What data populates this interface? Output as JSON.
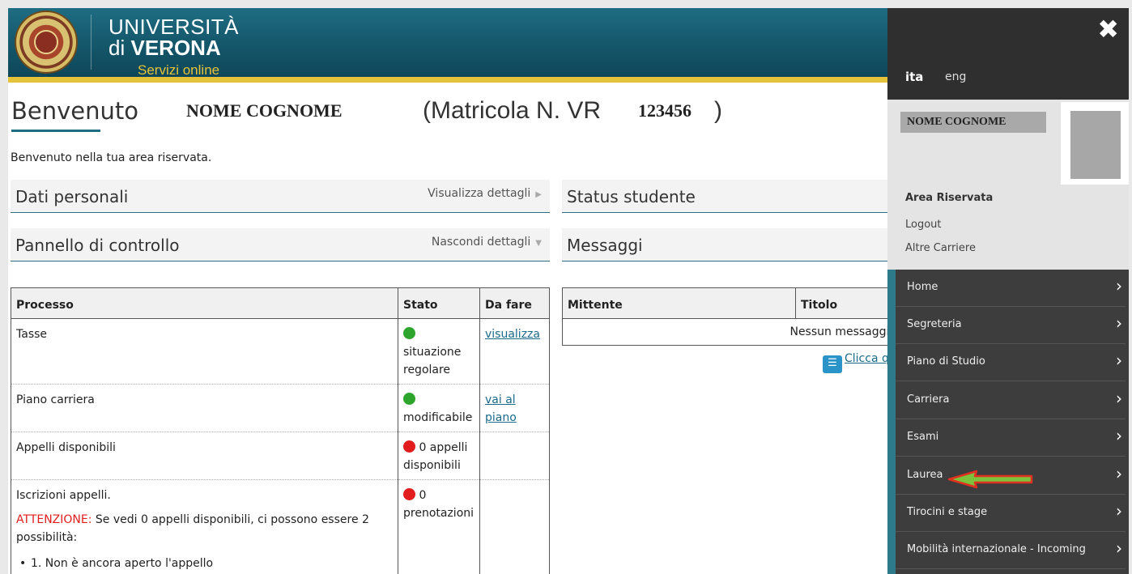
{
  "header": {
    "brand_line1": "UNIVERSITÀ",
    "brand_line2_prefix": "di",
    "brand_line2_bold": "VERONA",
    "brand_line3": "Servizi online",
    "colors": {
      "header": "#165a6e",
      "stripe": "#e4c33a"
    }
  },
  "welcome": {
    "title": "Benvenuto",
    "name": "NOME COGNOME",
    "matricola_prefix": "(Matricola N. VR",
    "matricola_number": "123456",
    "matricola_suffix": ")",
    "intro": "Benvenuto nella tua area riservata."
  },
  "sections": {
    "dati_personali": {
      "title": "Dati personali",
      "action": "Visualizza dettagli"
    },
    "pannello": {
      "title": "Pannello di controllo",
      "action": "Nascondi dettagli"
    },
    "status": {
      "title": "Status studente"
    },
    "messaggi": {
      "title": "Messaggi"
    }
  },
  "process_table": {
    "headers": [
      "Processo",
      "Stato",
      "Da fare"
    ],
    "rows": [
      {
        "processo": "Tasse",
        "status_color": "green",
        "stato": "situazione regolare",
        "azione": "visualizza"
      },
      {
        "processo": "Piano carriera",
        "status_color": "green",
        "stato": "modificabile",
        "azione": "vai al piano"
      },
      {
        "processo": "Appelli disponibili",
        "status_color": "red",
        "stato": "0 appelli disponibili",
        "azione": ""
      },
      {
        "processo": "Iscrizioni appelli.",
        "status_color": "red",
        "stato": "0 prenotazioni",
        "azione": "",
        "attenzione_label": "ATTENZIONE:",
        "attenzione_text": " Se vedi 0 appelli disponibili, ci possono essere 2 possibilità:",
        "bullet": "1. Non è ancora aperto l'appello"
      }
    ]
  },
  "messages_table": {
    "headers": [
      "Mittente",
      "Titolo"
    ],
    "empty": "Nessun messaggio",
    "link": "Clicca q"
  },
  "panel": {
    "close": "✖",
    "lang_active": "ita",
    "lang_other": "eng",
    "user_name": "NOME COGNOME",
    "area_riservata": "Area Riservata",
    "logout": "Logout",
    "altre_carriere": "Altre Carriere",
    "menu": [
      "Home",
      "Segreteria",
      "Piano di Studio",
      "Carriera",
      "Esami",
      "Laurea",
      "Tirocini e stage",
      "Mobilità internazionale - Incoming"
    ]
  }
}
